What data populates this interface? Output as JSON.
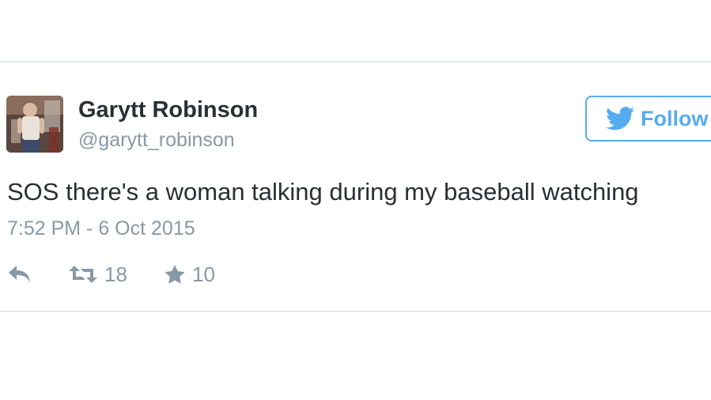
{
  "tweet": {
    "author": {
      "display_name": "Garytt Robinson",
      "screen_name": "@garytt_robinson",
      "avatar_icon": "user-avatar-photo"
    },
    "follow_button": {
      "label": "Follow",
      "icon": "twitter-bird-icon",
      "color": "#55acee"
    },
    "text": "SOS there's a woman talking during my baseball watching",
    "timestamp": "7:52 PM - 6 Oct 2015",
    "actions": {
      "reply": {
        "icon": "reply-icon"
      },
      "retweet": {
        "icon": "retweet-icon",
        "count": "18"
      },
      "favorite": {
        "icon": "star-icon",
        "count": "10"
      }
    }
  },
  "colors": {
    "text_primary": "#292f33",
    "text_secondary": "#8899a6",
    "divider": "#e1e8ed",
    "accent": "#55acee"
  }
}
